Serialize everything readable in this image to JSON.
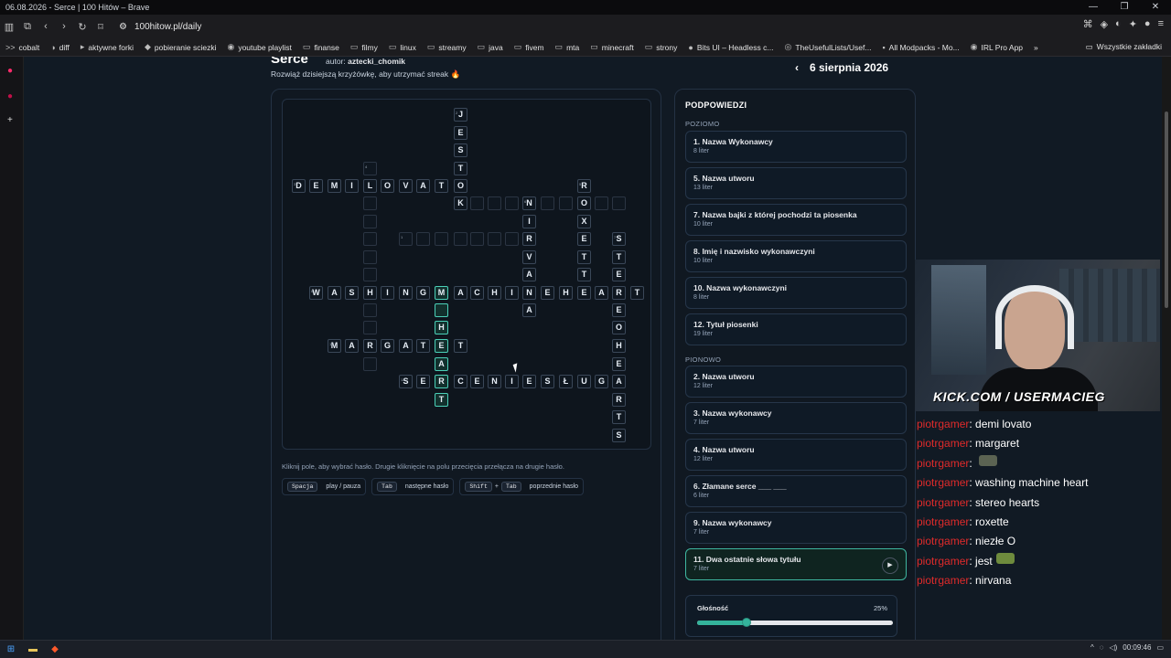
{
  "window": {
    "title": "06.08.2026 - Serce | 100 Hitów – Brave",
    "controls": [
      "—",
      "❐",
      "✕"
    ]
  },
  "browser": {
    "url": "100hitow.pl/daily",
    "bookmarks": [
      {
        "label": "cobalt",
        "icon": ">>"
      },
      {
        "label": "diff",
        "icon": "◑"
      },
      {
        "label": "aktywne forki",
        "icon": "▸"
      },
      {
        "label": "pobieranie sciezki",
        "icon": "◆"
      },
      {
        "label": "youtube playlist",
        "icon": "◉"
      },
      {
        "label": "finanse",
        "icon": "▭"
      },
      {
        "label": "filmy",
        "icon": "▭"
      },
      {
        "label": "linux",
        "icon": "▭"
      },
      {
        "label": "streamy",
        "icon": "▭"
      },
      {
        "label": "java",
        "icon": "▭"
      },
      {
        "label": "fivem",
        "icon": "▭"
      },
      {
        "label": "mta",
        "icon": "▭"
      },
      {
        "label": "minecraft",
        "icon": "▭"
      },
      {
        "label": "strony",
        "icon": "▭"
      },
      {
        "label": "Bits UI – Headless c...",
        "icon": "●"
      },
      {
        "label": "TheUsefulLists/Usef...",
        "icon": "◎"
      },
      {
        "label": "All Modpacks - Mo...",
        "icon": "▪"
      },
      {
        "label": "IRL Pro App",
        "icon": "◉"
      }
    ],
    "bookmarks_more": "»",
    "all_bookmarks": "Wszystkie zakładki"
  },
  "header": {
    "title": "Serce",
    "author_prefix": "autor:",
    "author": "aztecki_chomik",
    "subtitle": "Rozwiąż dzisiejszą krzyżówkę, aby utrzymać streak 🔥",
    "date": "6 sierpnia 2026",
    "prev": "‹"
  },
  "board_help": "Kliknij pole, aby wybrać hasło. Drugie kliknięcie na polu przecięcia przełącza na drugie hasło.",
  "shortcuts": [
    {
      "keys": [
        "Spacja"
      ],
      "label": "play / pauza"
    },
    {
      "keys": [
        "Tab"
      ],
      "label": "następne hasło"
    },
    {
      "keys": [
        "Shift",
        "Tab"
      ],
      "label": "poprzednie hasło"
    }
  ],
  "shortcut_plus": "+",
  "hints": {
    "title": "PODPOWIEDZI",
    "across_label": "POZIOMO",
    "down_label": "PIONOWO",
    "across": [
      {
        "text": "1. Nazwa Wykonawcy",
        "sub": "8 liter"
      },
      {
        "text": "5. Nazwa utworu",
        "sub": "13 liter"
      },
      {
        "text": "7. Nazwa bajki z której pochodzi ta piosenka",
        "sub": "10 liter"
      },
      {
        "text": "8. Imię i nazwisko wykonawczyni",
        "sub": "10 liter"
      },
      {
        "text": "10. Nazwa wykonawczyni",
        "sub": "8 liter"
      },
      {
        "text": "12. Tytuł piosenki",
        "sub": "19 liter"
      }
    ],
    "down": [
      {
        "text": "2. Nazwa utworu",
        "sub": "12 liter"
      },
      {
        "text": "3. Nazwa wykonawcy",
        "sub": "7 liter"
      },
      {
        "text": "4. Nazwa utworu",
        "sub": "12 liter"
      },
      {
        "text": "6. Złamane serce ___ ___",
        "sub": "6 liter"
      },
      {
        "text": "9. Nazwa wykonawcy",
        "sub": "7 liter"
      },
      {
        "text": "11. Dwa ostatnie słowa tytułu",
        "sub": "7 liter",
        "active": true
      }
    ],
    "play_icon": "▶"
  },
  "volume": {
    "label": "Głośność",
    "percent_text": "25%",
    "level": 0.25
  },
  "webcam_tag": "KICK.COM / USERMACIEG",
  "chat": [
    {
      "user": "piotrgamer",
      "text": "demi lovato"
    },
    {
      "user": "piotrgamer",
      "text": "margaret"
    },
    {
      "user": "piotrgamer",
      "text": "",
      "emote": "dark"
    },
    {
      "user": "piotrgamer",
      "text": "washing machine heart"
    },
    {
      "user": "piotrgamer",
      "text": "stereo hearts"
    },
    {
      "user": "piotrgamer",
      "text": "roxette"
    },
    {
      "user": "piotrgamer",
      "text": "niezłe O"
    },
    {
      "user": "piotrgamer",
      "text": "jest",
      "emote": "green"
    },
    {
      "user": "piotrgamer",
      "text": "nirvana"
    }
  ],
  "taskbar": {
    "time": "00:09:46"
  },
  "grid": {
    "cells": [
      [
        495,
        117,
        "J",
        "2"
      ],
      [
        495,
        137,
        "E",
        ""
      ],
      [
        495,
        156,
        "S",
        ""
      ],
      [
        495,
        176,
        "T",
        ""
      ],
      [
        318,
        195,
        "D",
        "3"
      ],
      [
        337,
        195,
        "E",
        ""
      ],
      [
        357,
        195,
        "M",
        ""
      ],
      [
        376,
        195,
        "I",
        ""
      ],
      [
        396,
        195,
        "L",
        ""
      ],
      [
        415,
        195,
        "O",
        ""
      ],
      [
        435,
        195,
        "V",
        ""
      ],
      [
        454,
        195,
        "A",
        ""
      ],
      [
        474,
        195,
        "T",
        ""
      ],
      [
        495,
        195,
        "O",
        ""
      ],
      [
        396,
        176,
        "",
        "4"
      ],
      [
        630,
        195,
        "R",
        "5"
      ],
      [
        495,
        214,
        "K",
        ""
      ],
      [
        513,
        214,
        "",
        ""
      ],
      [
        532,
        214,
        "",
        ""
      ],
      [
        551,
        214,
        "",
        ""
      ],
      [
        570,
        214,
        "N",
        "6"
      ],
      [
        590,
        214,
        "",
        ""
      ],
      [
        610,
        214,
        "",
        ""
      ],
      [
        630,
        214,
        "O",
        ""
      ],
      [
        649,
        214,
        "",
        ""
      ],
      [
        668,
        214,
        "",
        ""
      ],
      [
        396,
        214,
        "",
        ""
      ],
      [
        396,
        234,
        "",
        ""
      ],
      [
        396,
        253,
        "",
        ""
      ],
      [
        396,
        273,
        "",
        ""
      ],
      [
        396,
        292,
        "",
        ""
      ],
      [
        570,
        234,
        "I",
        ""
      ],
      [
        630,
        234,
        "X",
        ""
      ],
      [
        435,
        253,
        "",
        "1"
      ],
      [
        454,
        253,
        "",
        ""
      ],
      [
        474,
        253,
        "",
        ""
      ],
      [
        495,
        253,
        "",
        ""
      ],
      [
        513,
        253,
        "",
        ""
      ],
      [
        532,
        253,
        "",
        ""
      ],
      [
        551,
        253,
        "",
        ""
      ],
      [
        570,
        253,
        "R",
        ""
      ],
      [
        630,
        253,
        "E",
        ""
      ],
      [
        668,
        253,
        "S",
        "7"
      ],
      [
        570,
        273,
        "V",
        ""
      ],
      [
        630,
        273,
        "T",
        ""
      ],
      [
        668,
        273,
        "T",
        ""
      ],
      [
        570,
        292,
        "A",
        ""
      ],
      [
        630,
        292,
        "T",
        ""
      ],
      [
        668,
        292,
        "E",
        ""
      ],
      [
        337,
        312,
        "W",
        "8"
      ],
      [
        357,
        312,
        "A",
        ""
      ],
      [
        376,
        312,
        "S",
        ""
      ],
      [
        396,
        312,
        "H",
        ""
      ],
      [
        415,
        312,
        "I",
        ""
      ],
      [
        435,
        312,
        "N",
        ""
      ],
      [
        454,
        312,
        "G",
        ""
      ],
      [
        474,
        312,
        "M",
        "hl"
      ],
      [
        495,
        312,
        "A",
        ""
      ],
      [
        513,
        312,
        "C",
        ""
      ],
      [
        532,
        312,
        "H",
        ""
      ],
      [
        551,
        312,
        "I",
        ""
      ],
      [
        570,
        312,
        "N",
        ""
      ],
      [
        590,
        312,
        "E",
        ""
      ],
      [
        610,
        312,
        "H",
        ""
      ],
      [
        630,
        312,
        "E",
        ""
      ],
      [
        649,
        312,
        "A",
        ""
      ],
      [
        668,
        312,
        "R",
        ""
      ],
      [
        688,
        312,
        "T",
        ""
      ],
      [
        396,
        331,
        "",
        ""
      ],
      [
        474,
        331,
        "",
        "hl"
      ],
      [
        570,
        331,
        "A",
        ""
      ],
      [
        668,
        331,
        "E",
        ""
      ],
      [
        396,
        350,
        "",
        ""
      ],
      [
        474,
        350,
        "H",
        "hl"
      ],
      [
        668,
        350,
        "O",
        ""
      ],
      [
        357,
        370,
        "M",
        "10"
      ],
      [
        376,
        370,
        "A",
        ""
      ],
      [
        396,
        370,
        "R",
        ""
      ],
      [
        415,
        370,
        "G",
        ""
      ],
      [
        435,
        370,
        "A",
        ""
      ],
      [
        454,
        370,
        "T",
        ""
      ],
      [
        474,
        370,
        "E",
        "hl"
      ],
      [
        495,
        370,
        "T",
        ""
      ],
      [
        668,
        370,
        "H",
        ""
      ],
      [
        396,
        390,
        "",
        ""
      ],
      [
        474,
        390,
        "A",
        "hl"
      ],
      [
        668,
        390,
        "E",
        ""
      ],
      [
        435,
        409,
        "S",
        "12"
      ],
      [
        454,
        409,
        "E",
        ""
      ],
      [
        474,
        409,
        "R",
        "hl"
      ],
      [
        495,
        409,
        "C",
        ""
      ],
      [
        513,
        409,
        "E",
        ""
      ],
      [
        532,
        409,
        "N",
        ""
      ],
      [
        551,
        409,
        "I",
        ""
      ],
      [
        570,
        409,
        "E",
        ""
      ],
      [
        590,
        409,
        "S",
        ""
      ],
      [
        610,
        409,
        "Ł",
        ""
      ],
      [
        630,
        409,
        "U",
        ""
      ],
      [
        649,
        409,
        "G",
        ""
      ],
      [
        668,
        409,
        "A",
        ""
      ],
      [
        474,
        429,
        "T",
        "hl"
      ],
      [
        668,
        429,
        "R",
        ""
      ],
      [
        668,
        448,
        "T",
        ""
      ],
      [
        668,
        468,
        "S",
        ""
      ]
    ]
  }
}
